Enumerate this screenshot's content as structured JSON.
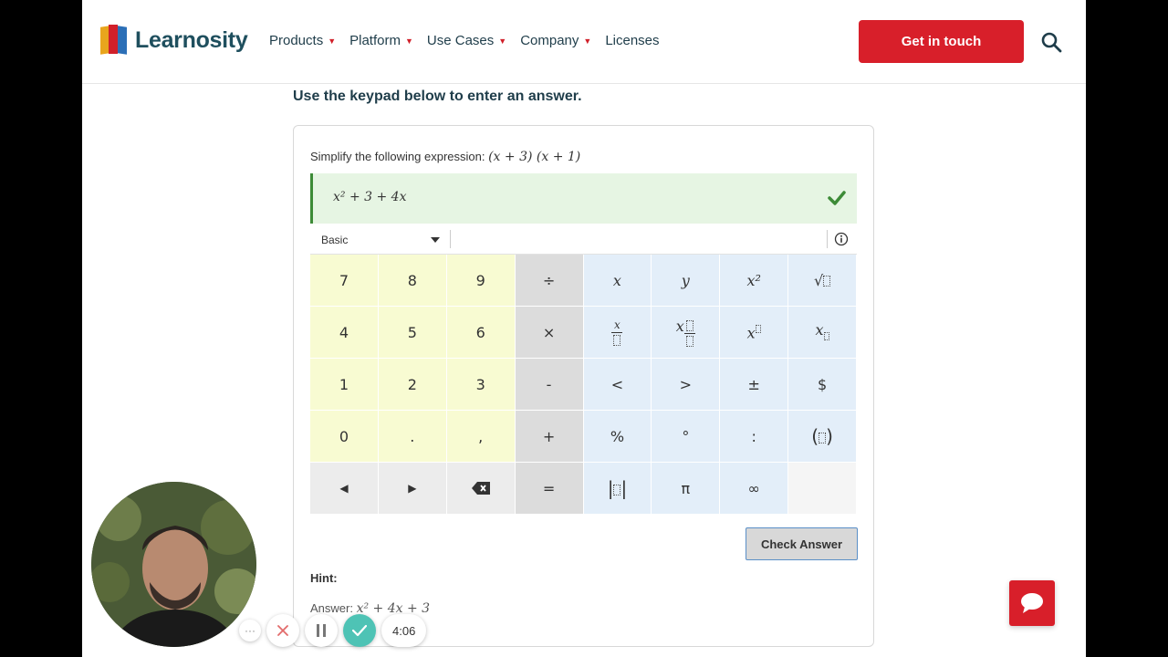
{
  "header": {
    "brand": "Learnosity",
    "nav": [
      {
        "label": "Products",
        "has_menu": true
      },
      {
        "label": "Platform",
        "has_menu": true
      },
      {
        "label": "Use Cases",
        "has_menu": true
      },
      {
        "label": "Company",
        "has_menu": true
      },
      {
        "label": "Licenses",
        "has_menu": false
      }
    ],
    "cta_label": "Get in touch",
    "search_icon": "search-icon",
    "accent_color": "#d81f2a"
  },
  "main": {
    "instruction": "Use the keypad below to enter an answer.",
    "question_prefix": "Simplify the following expression: ",
    "question_math": "(x + 3) (x + 1)",
    "answer": {
      "value": "x² + 3 + 4x",
      "status": "correct",
      "status_icon": "check-icon"
    },
    "keypad": {
      "mode": "Basic",
      "keys": [
        "7",
        "8",
        "9",
        "÷",
        "x",
        "y",
        "x²",
        "√",
        "4",
        "5",
        "6",
        "×",
        "x/□",
        "x□/□",
        "x^□",
        "x_□",
        "1",
        "2",
        "3",
        "-",
        "<",
        ">",
        "±",
        "$",
        "0",
        ".",
        ",",
        "+",
        "%",
        "°",
        ":",
        "(□)",
        "◂",
        "▸",
        "⌫",
        "=",
        "|□|",
        "π",
        "∞",
        ""
      ]
    },
    "check_answer_label": "Check Answer",
    "hint_label": "Hint:",
    "hint_answer_prefix": "Answer: ",
    "hint_answer_math": "x² + 4x + 3"
  },
  "chat": {
    "icon": "chat-icon"
  },
  "recorder": {
    "more_label": "···",
    "time": "4:06"
  }
}
